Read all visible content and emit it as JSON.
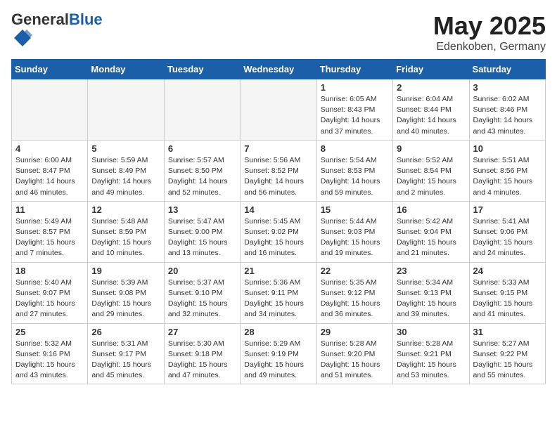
{
  "header": {
    "logo_general": "General",
    "logo_blue": "Blue",
    "title": "May 2025",
    "location": "Edenkoben, Germany"
  },
  "weekdays": [
    "Sunday",
    "Monday",
    "Tuesday",
    "Wednesday",
    "Thursday",
    "Friday",
    "Saturday"
  ],
  "weeks": [
    [
      {
        "day": "",
        "info": ""
      },
      {
        "day": "",
        "info": ""
      },
      {
        "day": "",
        "info": ""
      },
      {
        "day": "",
        "info": ""
      },
      {
        "day": "1",
        "info": "Sunrise: 6:05 AM\nSunset: 8:43 PM\nDaylight: 14 hours\nand 37 minutes."
      },
      {
        "day": "2",
        "info": "Sunrise: 6:04 AM\nSunset: 8:44 PM\nDaylight: 14 hours\nand 40 minutes."
      },
      {
        "day": "3",
        "info": "Sunrise: 6:02 AM\nSunset: 8:46 PM\nDaylight: 14 hours\nand 43 minutes."
      }
    ],
    [
      {
        "day": "4",
        "info": "Sunrise: 6:00 AM\nSunset: 8:47 PM\nDaylight: 14 hours\nand 46 minutes."
      },
      {
        "day": "5",
        "info": "Sunrise: 5:59 AM\nSunset: 8:49 PM\nDaylight: 14 hours\nand 49 minutes."
      },
      {
        "day": "6",
        "info": "Sunrise: 5:57 AM\nSunset: 8:50 PM\nDaylight: 14 hours\nand 52 minutes."
      },
      {
        "day": "7",
        "info": "Sunrise: 5:56 AM\nSunset: 8:52 PM\nDaylight: 14 hours\nand 56 minutes."
      },
      {
        "day": "8",
        "info": "Sunrise: 5:54 AM\nSunset: 8:53 PM\nDaylight: 14 hours\nand 59 minutes."
      },
      {
        "day": "9",
        "info": "Sunrise: 5:52 AM\nSunset: 8:54 PM\nDaylight: 15 hours\nand 2 minutes."
      },
      {
        "day": "10",
        "info": "Sunrise: 5:51 AM\nSunset: 8:56 PM\nDaylight: 15 hours\nand 4 minutes."
      }
    ],
    [
      {
        "day": "11",
        "info": "Sunrise: 5:49 AM\nSunset: 8:57 PM\nDaylight: 15 hours\nand 7 minutes."
      },
      {
        "day": "12",
        "info": "Sunrise: 5:48 AM\nSunset: 8:59 PM\nDaylight: 15 hours\nand 10 minutes."
      },
      {
        "day": "13",
        "info": "Sunrise: 5:47 AM\nSunset: 9:00 PM\nDaylight: 15 hours\nand 13 minutes."
      },
      {
        "day": "14",
        "info": "Sunrise: 5:45 AM\nSunset: 9:02 PM\nDaylight: 15 hours\nand 16 minutes."
      },
      {
        "day": "15",
        "info": "Sunrise: 5:44 AM\nSunset: 9:03 PM\nDaylight: 15 hours\nand 19 minutes."
      },
      {
        "day": "16",
        "info": "Sunrise: 5:42 AM\nSunset: 9:04 PM\nDaylight: 15 hours\nand 21 minutes."
      },
      {
        "day": "17",
        "info": "Sunrise: 5:41 AM\nSunset: 9:06 PM\nDaylight: 15 hours\nand 24 minutes."
      }
    ],
    [
      {
        "day": "18",
        "info": "Sunrise: 5:40 AM\nSunset: 9:07 PM\nDaylight: 15 hours\nand 27 minutes."
      },
      {
        "day": "19",
        "info": "Sunrise: 5:39 AM\nSunset: 9:08 PM\nDaylight: 15 hours\nand 29 minutes."
      },
      {
        "day": "20",
        "info": "Sunrise: 5:37 AM\nSunset: 9:10 PM\nDaylight: 15 hours\nand 32 minutes."
      },
      {
        "day": "21",
        "info": "Sunrise: 5:36 AM\nSunset: 9:11 PM\nDaylight: 15 hours\nand 34 minutes."
      },
      {
        "day": "22",
        "info": "Sunrise: 5:35 AM\nSunset: 9:12 PM\nDaylight: 15 hours\nand 36 minutes."
      },
      {
        "day": "23",
        "info": "Sunrise: 5:34 AM\nSunset: 9:13 PM\nDaylight: 15 hours\nand 39 minutes."
      },
      {
        "day": "24",
        "info": "Sunrise: 5:33 AM\nSunset: 9:15 PM\nDaylight: 15 hours\nand 41 minutes."
      }
    ],
    [
      {
        "day": "25",
        "info": "Sunrise: 5:32 AM\nSunset: 9:16 PM\nDaylight: 15 hours\nand 43 minutes."
      },
      {
        "day": "26",
        "info": "Sunrise: 5:31 AM\nSunset: 9:17 PM\nDaylight: 15 hours\nand 45 minutes."
      },
      {
        "day": "27",
        "info": "Sunrise: 5:30 AM\nSunset: 9:18 PM\nDaylight: 15 hours\nand 47 minutes."
      },
      {
        "day": "28",
        "info": "Sunrise: 5:29 AM\nSunset: 9:19 PM\nDaylight: 15 hours\nand 49 minutes."
      },
      {
        "day": "29",
        "info": "Sunrise: 5:28 AM\nSunset: 9:20 PM\nDaylight: 15 hours\nand 51 minutes."
      },
      {
        "day": "30",
        "info": "Sunrise: 5:28 AM\nSunset: 9:21 PM\nDaylight: 15 hours\nand 53 minutes."
      },
      {
        "day": "31",
        "info": "Sunrise: 5:27 AM\nSunset: 9:22 PM\nDaylight: 15 hours\nand 55 minutes."
      }
    ]
  ]
}
